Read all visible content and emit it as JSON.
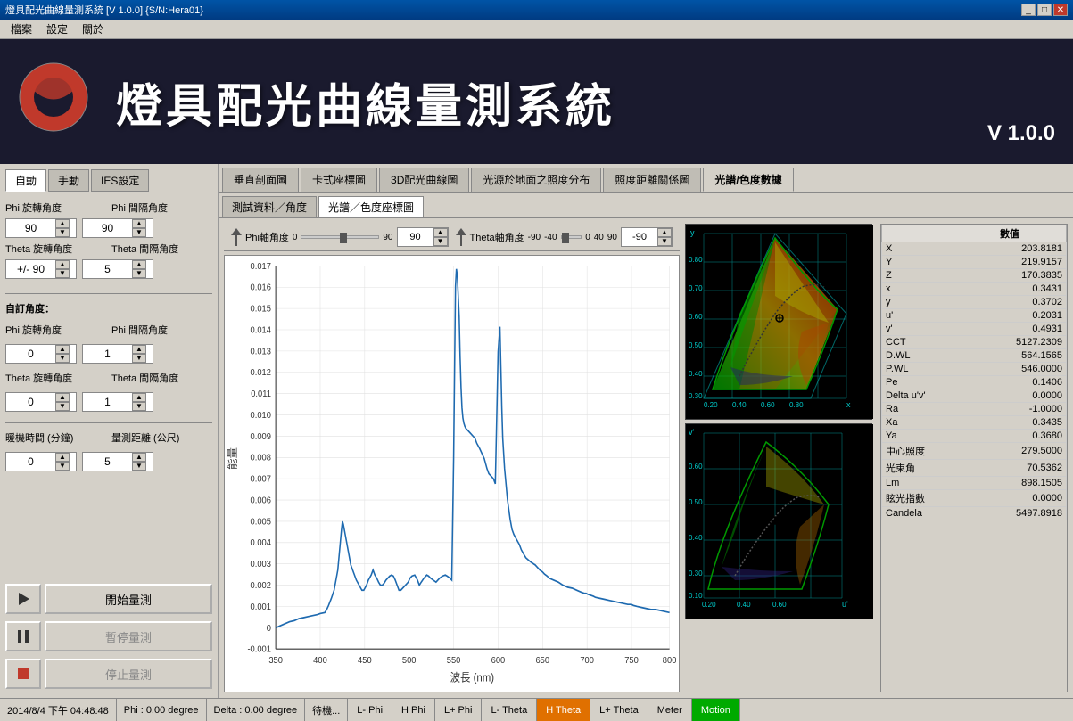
{
  "titlebar": {
    "title": "燈具配光曲線量測系統 [V 1.0.0] {S/N:Hera01}"
  },
  "menubar": {
    "items": [
      "檔案",
      "設定",
      "關於"
    ]
  },
  "header": {
    "title": "燈具配光曲線量測系統",
    "version": "V 1.0.0"
  },
  "left_panel": {
    "tabs": [
      "自動",
      "手動",
      "IES設定"
    ],
    "active_tab": "自動",
    "phi_rotation_label": "Phi 旋轉角度",
    "phi_interval_label": "Phi 間隔角度",
    "phi_rotation_value": "90",
    "phi_interval_value": "90",
    "theta_rotation_label": "Theta 旋轉角度",
    "theta_interval_label": "Theta 間隔角度",
    "theta_rotation_value": "+/- 90",
    "theta_interval_value": "5",
    "custom_angles_label": "自訂角度：",
    "custom_phi_rotation_label": "Phi 旋轉角度",
    "custom_phi_interval_label": "Phi 間隔角度",
    "custom_phi_rotation_value": "0",
    "custom_phi_interval_value": "1",
    "custom_theta_rotation_label": "Theta 旋轉角度",
    "custom_theta_interval_label": "Theta 間隔角度",
    "custom_theta_rotation_value": "0",
    "custom_theta_interval_value": "1",
    "wait_time_label": "暖機時間 (分鐘)",
    "measure_dist_label": "量測距離 (公尺)",
    "wait_time_value": "0",
    "measure_dist_value": "5",
    "start_btn": "開始量測",
    "pause_btn": "暫停量測",
    "stop_btn": "停止量測"
  },
  "top_tabs": {
    "items": [
      "垂直剖面圖",
      "卡式座標圖",
      "3D配光曲線圖",
      "光源於地面之照度分布",
      "照度距離關係圖",
      "光譜/色度數據"
    ],
    "active": "光譜/色度數據"
  },
  "sub_tabs": {
    "items": [
      "測試資料／角度",
      "光譜／色度座標圖"
    ],
    "active": "光譜／色度座標圖"
  },
  "angle_controls": {
    "phi_label": "Phi軸角度",
    "phi_value": "90",
    "phi_scale": [
      "0",
      "90"
    ],
    "theta_label": "Theta軸角度",
    "theta_value": "-90",
    "theta_scale": [
      "-90",
      "-40",
      "0",
      "40",
      "90"
    ]
  },
  "chart": {
    "x_label": "波長 (nm)",
    "y_label": "能量",
    "x_min": 350,
    "x_max": 800,
    "y_min": -0.001,
    "y_max": 0.017,
    "x_ticks": [
      350,
      400,
      450,
      500,
      550,
      600,
      650,
      700,
      750,
      800
    ],
    "y_ticks": [
      "0.017",
      "0.016",
      "0.015",
      "0.014",
      "0.013",
      "0.012",
      "0.011",
      "0.010",
      "0.009",
      "0.008",
      "0.007",
      "0.006",
      "0.005",
      "0.004",
      "0.003",
      "0.002",
      "0.001",
      "0",
      "-0.001"
    ]
  },
  "data_table": {
    "header": [
      "",
      "數值"
    ],
    "rows": [
      [
        "X",
        "203.8181"
      ],
      [
        "Y",
        "219.9157"
      ],
      [
        "Z",
        "170.3835"
      ],
      [
        "x",
        "0.3431"
      ],
      [
        "y",
        "0.3702"
      ],
      [
        "u'",
        "0.2031"
      ],
      [
        "v'",
        "0.4931"
      ],
      [
        "CCT",
        "5127.2309"
      ],
      [
        "D.WL",
        "564.1565"
      ],
      [
        "P.WL",
        "546.0000"
      ],
      [
        "Pe",
        "0.1406"
      ],
      [
        "Delta u'v'",
        "0.0000"
      ],
      [
        "Ra",
        "-1.0000"
      ],
      [
        "Xa",
        "0.3435"
      ],
      [
        "Ya",
        "0.3680"
      ],
      [
        "中心照度",
        "279.5000"
      ],
      [
        "光束角",
        "70.5362"
      ],
      [
        "Lm",
        "898.1505"
      ],
      [
        "眩光指數",
        "0.0000"
      ],
      [
        "Candela",
        "5497.8918"
      ]
    ]
  },
  "statusbar": {
    "datetime": "2014/8/4 下午 04:48:48",
    "phi_degree": "Phi : 0.00 degree",
    "delta_degree": "Delta : 0.00 degree",
    "status": "待機...",
    "buttons": [
      "L- Phi",
      "H Phi",
      "L+ Phi",
      "L- Theta",
      "H Theta",
      "L+ Theta",
      "Meter",
      "Motion"
    ]
  }
}
